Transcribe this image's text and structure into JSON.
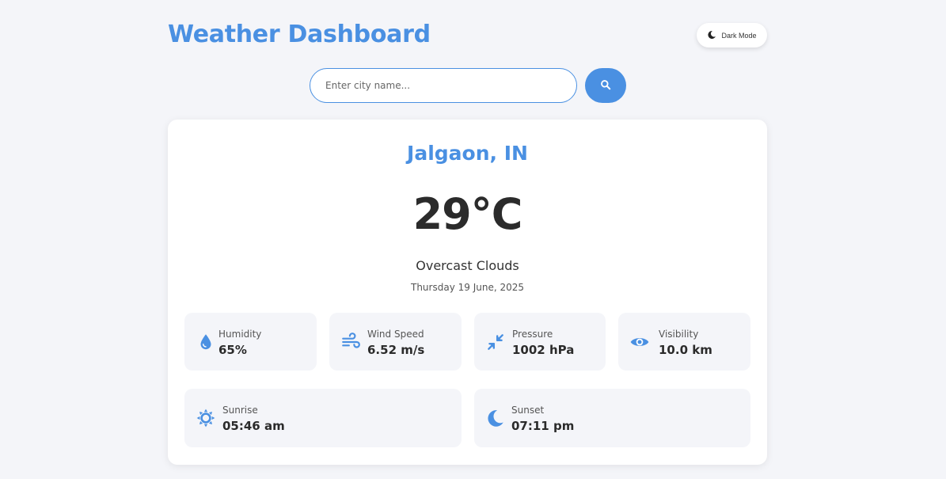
{
  "header": {
    "title": "Weather Dashboard",
    "theme_toggle_label": "Dark Mode"
  },
  "search": {
    "placeholder": "Enter city name...",
    "value": ""
  },
  "weather": {
    "city": "Jalgaon, IN",
    "temperature": "29°C",
    "description": "Overcast Clouds",
    "date": "Thursday 19 June, 2025"
  },
  "details": [
    {
      "label": "Humidity",
      "value": "65%",
      "icon": "water-drop-icon"
    },
    {
      "label": "Wind Speed",
      "value": "6.52 m/s",
      "icon": "wind-icon"
    },
    {
      "label": "Pressure",
      "value": "1002 hPa",
      "icon": "compress-arrows-icon"
    },
    {
      "label": "Visibility",
      "value": "10.0 km",
      "icon": "eye-icon"
    }
  ],
  "sun": [
    {
      "label": "Sunrise",
      "value": "05:46 am",
      "icon": "sun-icon"
    },
    {
      "label": "Sunset",
      "value": "07:11 pm",
      "icon": "moon-icon"
    }
  ],
  "colors": {
    "accent": "#4a90e2",
    "background": "#f4f5f9",
    "card": "#ffffff",
    "tile": "#f4f5f9"
  }
}
